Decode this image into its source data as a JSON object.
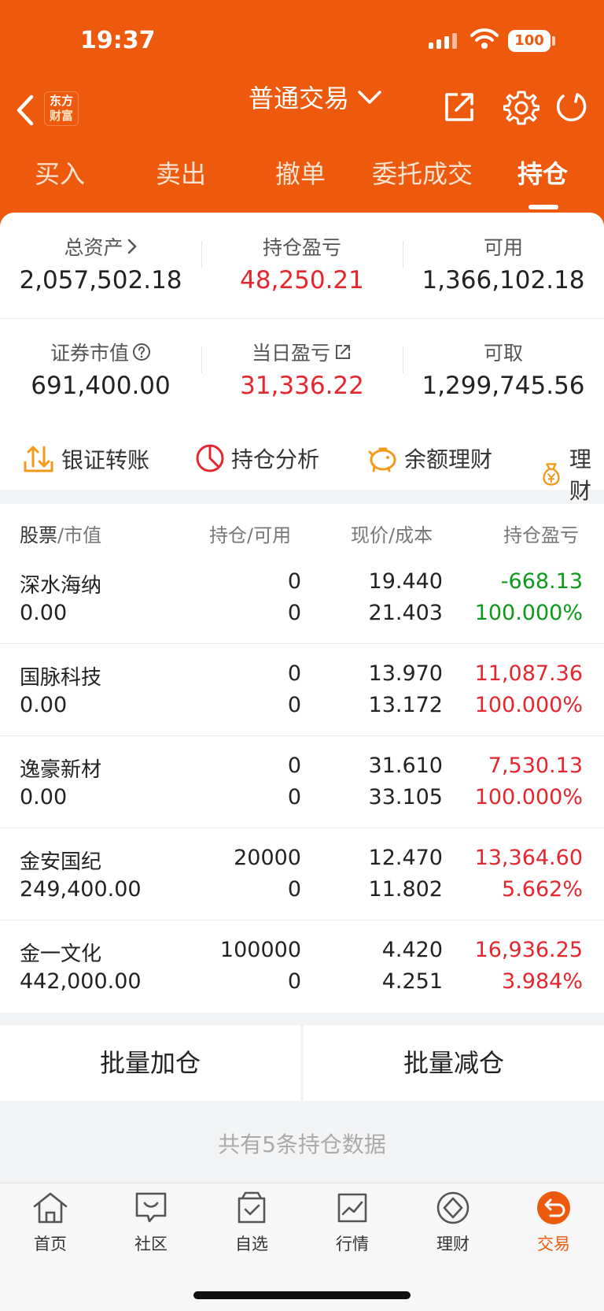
{
  "status": {
    "time": "19:37",
    "battery": "100"
  },
  "header": {
    "logo_line1": "东方",
    "logo_line2": "财富",
    "title": "普通交易"
  },
  "tabs": [
    {
      "label": "买入"
    },
    {
      "label": "卖出"
    },
    {
      "label": "撤单"
    },
    {
      "label": "委托成交"
    },
    {
      "label": "持仓",
      "active": true
    }
  ],
  "summary": {
    "total_assets": {
      "label": "总资产",
      "value": "2,057,502.18"
    },
    "position_pl": {
      "label": "持仓盈亏",
      "value": "48,250.21"
    },
    "available": {
      "label": "可用",
      "value": "1,366,102.18"
    },
    "market_value": {
      "label": "证券市值",
      "value": "691,400.00"
    },
    "daily_pl": {
      "label": "当日盈亏",
      "value": "31,336.22"
    },
    "withdrawable": {
      "label": "可取",
      "value": "1,299,745.56"
    }
  },
  "shortcuts": [
    {
      "label": "银证转账",
      "icon": "transfer-icon"
    },
    {
      "label": "持仓分析",
      "icon": "pie-chart-icon"
    },
    {
      "label": "余额理财",
      "icon": "piggy-bank-icon"
    },
    {
      "label": "理财",
      "icon": "money-bag-icon"
    }
  ],
  "table": {
    "headers": {
      "stock_a": "股票",
      "stock_b": "市值",
      "hold_a": "持仓",
      "hold_b": "可用",
      "price_a": "现价",
      "price_b": "成本",
      "pl": "持仓盈亏"
    },
    "rows": [
      {
        "name": "深水海纳",
        "mv": "0.00",
        "hold": "0",
        "avail": "0",
        "price": "19.440",
        "cost": "21.403",
        "pl": "-668.13",
        "pl_pct": "100.000%",
        "trend": "down"
      },
      {
        "name": "国脉科技",
        "mv": "0.00",
        "hold": "0",
        "avail": "0",
        "price": "13.970",
        "cost": "13.172",
        "pl": "11,087.36",
        "pl_pct": "100.000%",
        "trend": "up"
      },
      {
        "name": "逸豪新材",
        "mv": "0.00",
        "hold": "0",
        "avail": "0",
        "price": "31.610",
        "cost": "33.105",
        "pl": "7,530.13",
        "pl_pct": "100.000%",
        "trend": "up"
      },
      {
        "name": "金安国纪",
        "mv": "249,400.00",
        "hold": "20000",
        "avail": "0",
        "price": "12.470",
        "cost": "11.802",
        "pl": "13,364.60",
        "pl_pct": "5.662%",
        "trend": "up"
      },
      {
        "name": "金一文化",
        "mv": "442,000.00",
        "hold": "100000",
        "avail": "0",
        "price": "4.420",
        "cost": "4.251",
        "pl": "16,936.25",
        "pl_pct": "3.984%",
        "trend": "up"
      }
    ]
  },
  "actions": {
    "batch_add": "批量加仓",
    "batch_reduce": "批量减仓"
  },
  "footer_note": "共有5条持仓数据",
  "nav": [
    {
      "label": "首页",
      "icon": "home-icon"
    },
    {
      "label": "社区",
      "icon": "community-icon"
    },
    {
      "label": "自选",
      "icon": "watchlist-icon"
    },
    {
      "label": "行情",
      "icon": "market-icon"
    },
    {
      "label": "理财",
      "icon": "wealth-icon"
    },
    {
      "label": "交易",
      "icon": "trade-icon",
      "active": true
    }
  ],
  "colors": {
    "brand": "#ee5a0d",
    "up": "#e5262e",
    "down": "#0c9a1a"
  }
}
